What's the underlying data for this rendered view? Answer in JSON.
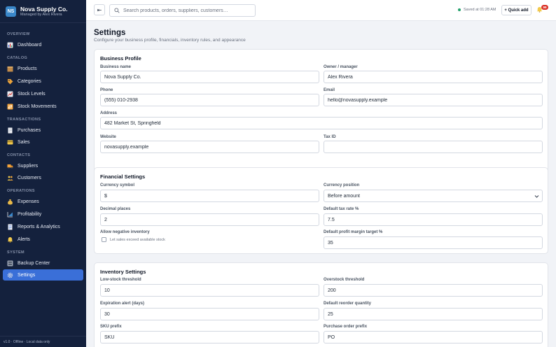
{
  "brand": {
    "initials": "NS",
    "name": "Nova Supply Co.",
    "subtitle": "Managed by Alex Rivera"
  },
  "nav": {
    "sections": [
      {
        "label": "OVERVIEW"
      },
      {
        "label": "CATALOG"
      },
      {
        "label": "TRANSACTIONS"
      },
      {
        "label": "CONTACTS"
      },
      {
        "label": "OPERATIONS"
      },
      {
        "label": "SYSTEM"
      }
    ],
    "items": [
      {
        "label": "Dashboard",
        "icon": "chart-icon"
      },
      {
        "label": "Products",
        "icon": "box-icon"
      },
      {
        "label": "Categories",
        "icon": "tag-icon"
      },
      {
        "label": "Stock Levels",
        "icon": "stock-chart-icon"
      },
      {
        "label": "Stock Movements",
        "icon": "arrows-icon"
      },
      {
        "label": "Purchases",
        "icon": "receipt-icon"
      },
      {
        "label": "Sales",
        "icon": "card-icon"
      },
      {
        "label": "Suppliers",
        "icon": "truck-icon"
      },
      {
        "label": "Customers",
        "icon": "people-icon"
      },
      {
        "label": "Expenses",
        "icon": "money-bag-icon"
      },
      {
        "label": "Profitability",
        "icon": "trend-icon"
      },
      {
        "label": "Reports & Analytics",
        "icon": "report-icon"
      },
      {
        "label": "Alerts",
        "icon": "bell-icon"
      },
      {
        "label": "Backup Center",
        "icon": "backup-icon"
      },
      {
        "label": "Settings",
        "icon": "gear-icon",
        "active": true
      }
    ],
    "footer": "v1.0 · Offline · Local data only"
  },
  "topbar": {
    "search_placeholder": "Search products, orders, suppliers, customers…",
    "saved_status": "Saved at 01:28 AM",
    "quick_add": "+ Quick add",
    "notification_count": "99"
  },
  "page": {
    "title": "Settings",
    "subtitle": "Configure your business profile, financials, inventory rules, and appearance"
  },
  "business_profile": {
    "title": "Business Profile",
    "business_name": {
      "label": "Business name",
      "value": "Nova Supply Co."
    },
    "owner": {
      "label": "Owner / manager",
      "value": "Alex Rivera"
    },
    "phone": {
      "label": "Phone",
      "value": "(555) 010-2938"
    },
    "email": {
      "label": "Email",
      "value": "hello@novasupply.example"
    },
    "address": {
      "label": "Address",
      "value": "482 Market St, Springfield"
    },
    "website": {
      "label": "Website",
      "value": "novasupply.example"
    },
    "tax_id": {
      "label": "Tax ID",
      "value": ""
    }
  },
  "financial_settings": {
    "title": "Financial Settings",
    "currency_symbol": {
      "label": "Currency symbol",
      "value": "$"
    },
    "currency_position": {
      "label": "Currency position",
      "value": "Before amount"
    },
    "decimal_places": {
      "label": "Decimal places",
      "value": "2"
    },
    "tax_rate": {
      "label": "Default tax rate %",
      "value": "7.5"
    },
    "negative_inventory": {
      "label": "Allow negative inventory",
      "checkbox_label": "Let sales exceed available stock",
      "checked": false
    },
    "profit_margin": {
      "label": "Default profit margin target %",
      "value": "35"
    }
  },
  "inventory_settings": {
    "title": "Inventory Settings",
    "low_stock": {
      "label": "Low-stock threshold",
      "value": "10"
    },
    "overstock": {
      "label": "Overstock threshold",
      "value": "200"
    },
    "expiration_alert": {
      "label": "Expiration alert (days)",
      "value": "30"
    },
    "reorder_qty": {
      "label": "Default reorder quantity",
      "value": "25"
    },
    "sku_prefix": {
      "label": "SKU prefix",
      "value": "SKU"
    },
    "po_prefix": {
      "label": "Purchase order prefix",
      "value": "PO"
    }
  },
  "colors": {
    "sidebar_bg": "#14213d",
    "accent": "#3a6fd8",
    "badge": "#d93025",
    "saved_dot": "#22a06b"
  }
}
